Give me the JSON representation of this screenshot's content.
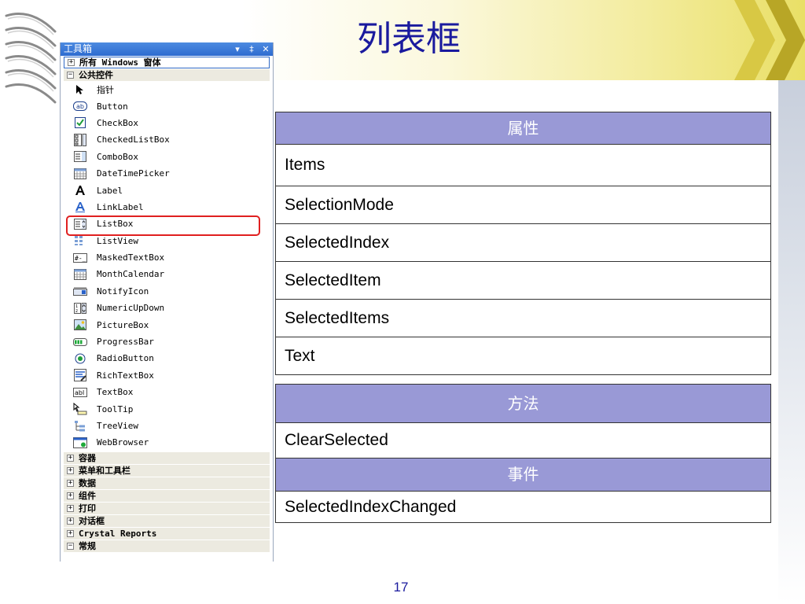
{
  "slide": {
    "title": "列表框",
    "page_number": "17"
  },
  "toolbox": {
    "title": "工具箱",
    "controls": [
      "▾",
      "‡",
      "✕"
    ],
    "top_category": "所有 Windows 窗体",
    "common_category": "公共控件",
    "items": [
      {
        "label": "指针",
        "icon": "pointer-icon"
      },
      {
        "label": "Button",
        "icon": "button-icon"
      },
      {
        "label": "CheckBox",
        "icon": "checkbox-icon"
      },
      {
        "label": "CheckedListBox",
        "icon": "checkedlistbox-icon"
      },
      {
        "label": "ComboBox",
        "icon": "combobox-icon"
      },
      {
        "label": "DateTimePicker",
        "icon": "datetimepicker-icon"
      },
      {
        "label": "Label",
        "icon": "label-icon"
      },
      {
        "label": "LinkLabel",
        "icon": "linklabel-icon"
      },
      {
        "label": "ListBox",
        "icon": "listbox-icon"
      },
      {
        "label": "ListView",
        "icon": "listview-icon"
      },
      {
        "label": "MaskedTextBox",
        "icon": "maskedtextbox-icon"
      },
      {
        "label": "MonthCalendar",
        "icon": "monthcalendar-icon"
      },
      {
        "label": "NotifyIcon",
        "icon": "notifyicon-icon"
      },
      {
        "label": "NumericUpDown",
        "icon": "numericupdown-icon"
      },
      {
        "label": "PictureBox",
        "icon": "picturebox-icon"
      },
      {
        "label": "ProgressBar",
        "icon": "progressbar-icon"
      },
      {
        "label": "RadioButton",
        "icon": "radiobutton-icon"
      },
      {
        "label": "RichTextBox",
        "icon": "richtextbox-icon"
      },
      {
        "label": "TextBox",
        "icon": "textbox-icon"
      },
      {
        "label": "ToolTip",
        "icon": "tooltip-icon"
      },
      {
        "label": "TreeView",
        "icon": "treeview-icon"
      },
      {
        "label": "WebBrowser",
        "icon": "webbrowser-icon"
      }
    ],
    "categories": [
      "容器",
      "菜单和工具栏",
      "数据",
      "组件",
      "打印",
      "对话框",
      "Crystal Reports",
      "常规"
    ],
    "highlight_color": "#e02020"
  },
  "tables": {
    "properties": {
      "header": "属性",
      "rows": [
        "Items",
        "SelectionMode",
        "SelectedIndex",
        "SelectedItem",
        "SelectedItems",
        "Text"
      ]
    },
    "methods": {
      "header": "方法",
      "rows": [
        "ClearSelected"
      ]
    },
    "events": {
      "header": "事件",
      "rows": [
        "SelectedIndexChanged"
      ]
    },
    "header_color": "#9999d6"
  }
}
